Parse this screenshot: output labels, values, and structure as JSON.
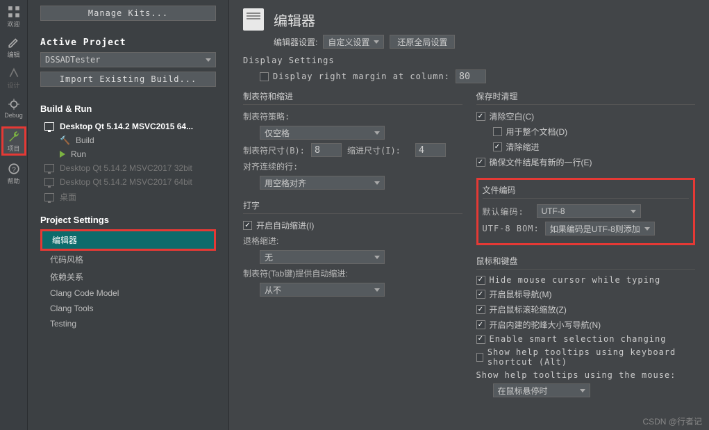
{
  "rail": {
    "items": [
      "欢迎",
      "编辑",
      "设计",
      "Debug",
      "项目",
      "帮助"
    ]
  },
  "side": {
    "manage": "Manage Kits...",
    "active_title": "Active Project",
    "project": "DSSADTester",
    "import": "Import Existing Build...",
    "buildrun": "Build & Run",
    "kits": [
      {
        "label": "Desktop Qt 5.14.2 MSVC2015 64...",
        "bold": true
      },
      {
        "label": "Build",
        "icon": "hammer"
      },
      {
        "label": "Run",
        "icon": "play"
      },
      {
        "label": "Desktop Qt 5.14.2 MSVC2017 32bit",
        "disabled": true
      },
      {
        "label": "Desktop Qt 5.14.2 MSVC2017 64bit",
        "disabled": true
      },
      {
        "label": "桌面",
        "disabled": true
      }
    ],
    "settings_title": "Project Settings",
    "settings": [
      "编辑器",
      "代码风格",
      "依赖关系",
      "Clang Code Model",
      "Clang Tools",
      "Testing"
    ]
  },
  "main": {
    "title": "编辑器",
    "settings_label": "编辑器设置:",
    "settings_value": "自定义设置",
    "restore": "还原全局设置",
    "display_settings": "Display Settings",
    "display_margin": "Display right margin at column:",
    "margin_col": "80",
    "tabs": {
      "title": "制表符和缩进",
      "policy_label": "制表符策略:",
      "policy_value": "仅空格",
      "tabsize_label": "制表符尺寸(B):",
      "tabsize": "8",
      "indent_label": "缩进尺寸(I):",
      "indent": "4",
      "align_label": "对齐连续的行:",
      "align_value": "用空格对齐"
    },
    "typing": {
      "title": "打字",
      "auto_indent": "开启自动缩进(I)",
      "backspace_label": "退格缩进:",
      "backspace_value": "无",
      "tab_label": "制表符(Tab键)提供自动缩进:",
      "tab_value": "从不"
    },
    "cleanup": {
      "title": "保存时清理",
      "clean_ws": "清除空白(C)",
      "whole_doc": "用于整个文档(D)",
      "clean_indent": "清除缩进",
      "ensure_nl": "确保文件结尾有新的一行(E)"
    },
    "encoding": {
      "title": "文件编码",
      "default_label": "默认编码:",
      "default_value": "UTF-8",
      "bom_label": "UTF-8 BOM:",
      "bom_value": "如果编码是UTF-8则添加"
    },
    "mouse": {
      "title": "鼠标和键盘",
      "hide_cursor": "Hide mouse cursor while typing",
      "nav": "开启鼠标导航(M)",
      "zoom": "开启鼠标滚轮缩放(Z)",
      "camel": "开启内建的驼峰大小写导航(N)",
      "smart_sel": "Enable smart selection changing",
      "help_kb": "Show help tooltips using keyboard shortcut (Alt)",
      "help_mouse_label": "Show help tooltips using the mouse:",
      "help_mouse_value": "在鼠标悬停时"
    }
  },
  "watermark": "CSDN @行者记"
}
